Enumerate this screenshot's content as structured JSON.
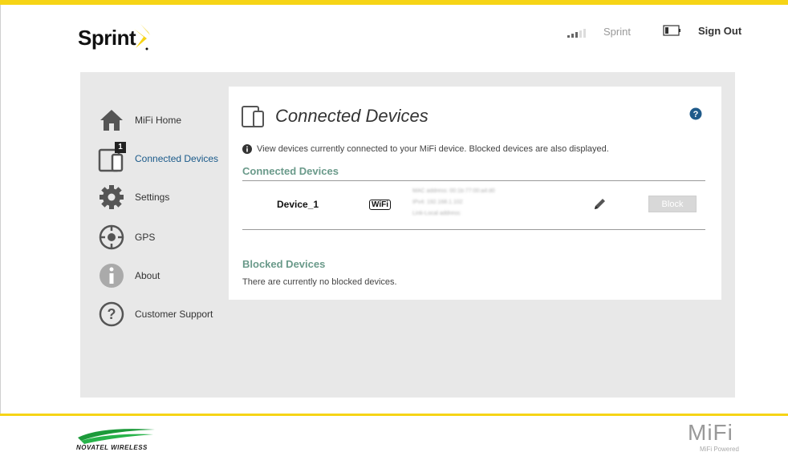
{
  "header": {
    "brand": "Sprint",
    "carrier": "Sprint",
    "sign_out": "Sign Out"
  },
  "sidebar": {
    "items": [
      {
        "label": "MiFi Home",
        "icon": "home-icon"
      },
      {
        "label": "Connected Devices",
        "icon": "devices-icon",
        "badge": "1",
        "active": true
      },
      {
        "label": "Settings",
        "icon": "gear-icon"
      },
      {
        "label": "GPS",
        "icon": "gps-icon"
      },
      {
        "label": "About",
        "icon": "info-icon"
      },
      {
        "label": "Customer Support",
        "icon": "question-icon"
      }
    ]
  },
  "main": {
    "title": "Connected Devices",
    "info": "View devices currently connected to your MiFi device. Blocked devices are also displayed.",
    "connected_title": "Connected Devices",
    "devices": [
      {
        "name": "Device_1",
        "connection": "WiFi",
        "details": [
          "MAC address: 00:1b:77:00:a4:d0",
          "IPv4: 192.168.1.102",
          "Link-Local address:"
        ],
        "block_label": "Block"
      }
    ],
    "blocked_title": "Blocked Devices",
    "blocked_message": "There are currently no blocked devices."
  },
  "footer": {
    "novatel": "NOVATEL WIRELESS",
    "mifi": "MiFi",
    "mifi_sub": "MiFi Powered"
  },
  "colors": {
    "accent": "#f6d416",
    "section_title": "#6a9a8a",
    "active_nav": "#1a5a8a",
    "help": "#1f5a8a"
  }
}
